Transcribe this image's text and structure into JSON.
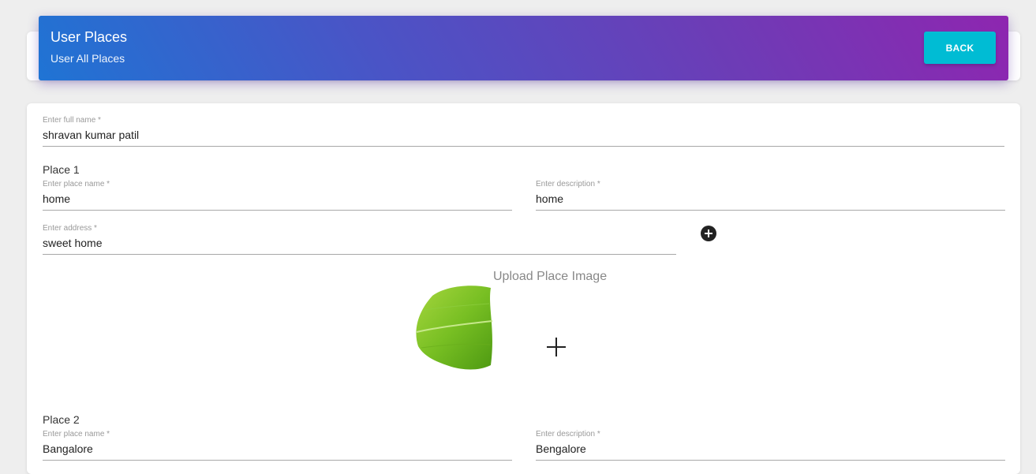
{
  "header": {
    "title": "User Places",
    "subtitle": "User All Places",
    "back_label": "BACK",
    "gradient_colors": [
      "#1f74d4",
      "#8e26b0"
    ],
    "back_color": "#00bcd4"
  },
  "form": {
    "full_name": {
      "label": "Enter full name *",
      "value": "shravan kumar patil"
    },
    "places": [
      {
        "heading": "Place 1",
        "place_name": {
          "label": "Enter place name *",
          "value": "home"
        },
        "description": {
          "label": "Enter description *",
          "value": "home"
        },
        "address": {
          "label": "Enter address *",
          "value": "sweet home"
        },
        "upload_label": "Upload Place Image",
        "image_icon": "banana-leaf-image",
        "add_icon": "plus-circle-icon",
        "upload_icon": "plus-icon"
      },
      {
        "heading": "Place 2",
        "place_name": {
          "label": "Enter place name *",
          "value": "Bangalore"
        },
        "description": {
          "label": "Enter description *",
          "value": "Bengalore"
        }
      }
    ]
  }
}
